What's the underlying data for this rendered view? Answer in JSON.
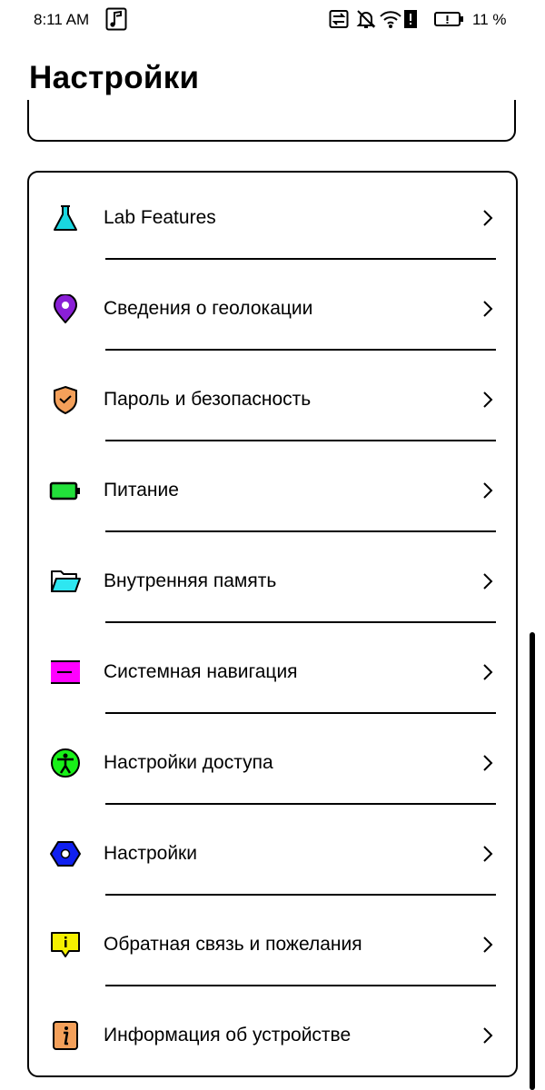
{
  "status_bar": {
    "time": "8:11 AM",
    "battery_percent": "11 %",
    "icons": [
      "music-note-icon",
      "sync-icon",
      "notifications-off-icon",
      "wifi-alert-icon",
      "battery-low-icon"
    ]
  },
  "page": {
    "title": "Настройки"
  },
  "settings": {
    "items": [
      {
        "label": "Lab Features",
        "icon": "flask-icon",
        "color": "#19d6e0"
      },
      {
        "label": "Сведения о геолокации",
        "icon": "location-pin-icon",
        "color": "#8a1fd6"
      },
      {
        "label": "Пароль и безопасность",
        "icon": "shield-check-icon",
        "color": "#f4a05a"
      },
      {
        "label": "Питание",
        "icon": "battery-icon",
        "color": "#22e03a"
      },
      {
        "label": "Внутренняя память",
        "icon": "folder-icon",
        "color": "#2ee6f0"
      },
      {
        "label": "Системная навигация",
        "icon": "navigation-bar-icon",
        "color": "#ff00ff"
      },
      {
        "label": "Настройки доступа",
        "icon": "accessibility-icon",
        "color": "#18f018"
      },
      {
        "label": "Настройки",
        "icon": "hex-nut-icon",
        "color": "#1020f0"
      },
      {
        "label": "Обратная связь и пожелания",
        "icon": "feedback-icon",
        "color": "#f5f000"
      },
      {
        "label": "Информация об устройстве",
        "icon": "info-icon",
        "color": "#f4a05a"
      }
    ]
  }
}
